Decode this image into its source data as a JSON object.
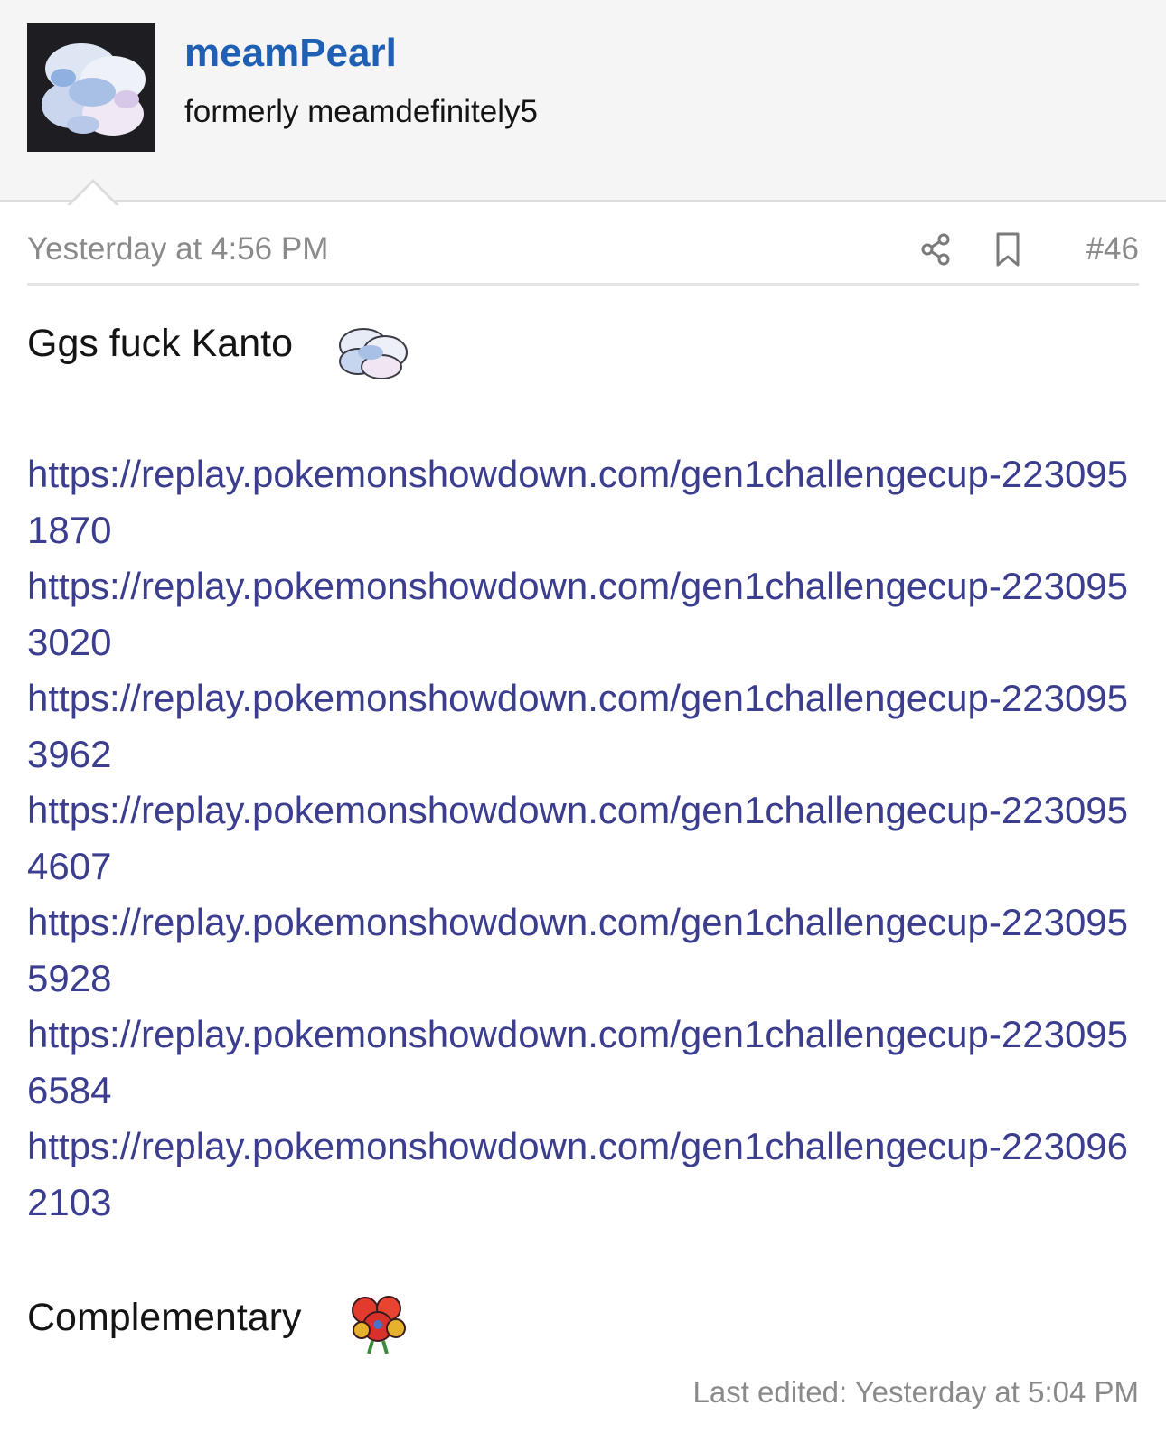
{
  "header": {
    "username": "meamPearl",
    "user_title": "formerly meamdefinitely5"
  },
  "meta": {
    "timestamp": "Yesterday at 4:56 PM",
    "post_number": "#46",
    "icons": [
      "share-icon",
      "bookmark-icon"
    ]
  },
  "post": {
    "line1": "Ggs fuck Kanto",
    "links": [
      "https://replay.pokemonshowdown.com/gen1challengecup-2230951870",
      "https://replay.pokemonshowdown.com/gen1challengecup-2230953020",
      "https://replay.pokemonshowdown.com/gen1challengecup-2230953962",
      "https://replay.pokemonshowdown.com/gen1challengecup-2230954607",
      "https://replay.pokemonshowdown.com/gen1challengecup-2230955928",
      "https://replay.pokemonshowdown.com/gen1challengecup-2230956584",
      "https://replay.pokemonshowdown.com/gen1challengecup-2230962103"
    ],
    "line2": "Complementary",
    "last_edited": "Last edited: Yesterday at 5:04 PM"
  },
  "colors": {
    "username": "#1f5fb4",
    "link": "#3b3d8e",
    "muted": "#8a8a8a",
    "header_bg": "#f5f5f5"
  }
}
